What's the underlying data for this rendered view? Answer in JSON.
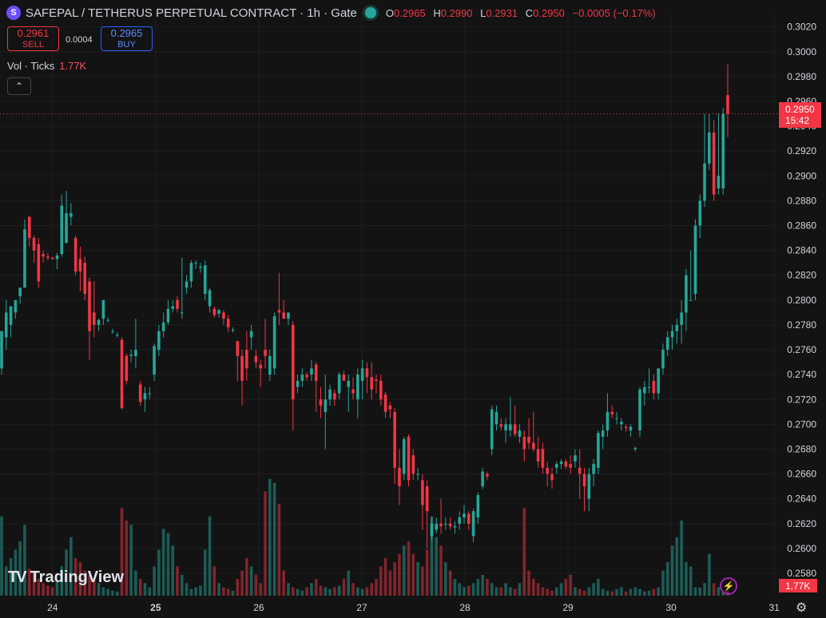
{
  "header": {
    "logo": "S",
    "title": "SAFEPAL / TETHERUS PERPETUAL CONTRACT · 1h · Gate",
    "ohlc": [
      {
        "k": "O",
        "v": "0.2965"
      },
      {
        "k": "H",
        "v": "0.2990"
      },
      {
        "k": "L",
        "v": "0.2931"
      },
      {
        "k": "C",
        "v": "0.2950"
      }
    ],
    "change": "−0.0005 (−0.17%)"
  },
  "trade": {
    "sell_price": "0.2961",
    "sell_label": "SELL",
    "spread": "0.0004",
    "buy_price": "0.2965",
    "buy_label": "BUY"
  },
  "volume_legend": {
    "label": "Vol · Ticks",
    "value": "1.77K"
  },
  "collapse_glyph": "⌃",
  "branding": {
    "mark": "TV",
    "text": "TradingView"
  },
  "colors": {
    "bg": "#131313",
    "up": "#26a69a",
    "down": "#f23645",
    "grid": "#1e1e1e",
    "text": "#d1d4dc"
  },
  "icons": [
    "logo-icon",
    "status-dot-icon",
    "chevron-up-icon",
    "bolt-icon",
    "gear-icon"
  ],
  "chart_data": {
    "type": "candlestick",
    "timeframe": "1h",
    "price_axis": {
      "min": 0.2562,
      "max": 0.3032,
      "ticks": [
        "0.3020",
        "0.3000",
        "0.2980",
        "0.2960",
        "0.2940",
        "0.2920",
        "0.2900",
        "0.2880",
        "0.2860",
        "0.2840",
        "0.2820",
        "0.2800",
        "0.2780",
        "0.2760",
        "0.2740",
        "0.2720",
        "0.2700",
        "0.2680",
        "0.2660",
        "0.2640",
        "0.2620",
        "0.2600",
        "0.2580"
      ]
    },
    "time_axis": [
      {
        "label": "24",
        "x": 24.0,
        "bold": false
      },
      {
        "label": "25",
        "x": 25.0,
        "bold": true
      },
      {
        "label": "26",
        "x": 26.0,
        "bold": false
      },
      {
        "label": "27",
        "x": 27.0,
        "bold": false
      },
      {
        "label": "28",
        "x": 28.0,
        "bold": false
      },
      {
        "label": "29",
        "x": 29.0,
        "bold": false
      },
      {
        "label": "30",
        "x": 30.0,
        "bold": false
      },
      {
        "label": "31",
        "x": 31.0,
        "bold": false
      }
    ],
    "x_range": [
      23.49,
      31.03
    ],
    "current_price": {
      "price": "0.2950",
      "countdown": "15:42",
      "value": 0.295
    },
    "volume_badge": "1.77K",
    "volume_max": 1.77,
    "candles": [
      {
        "o": 0.2745,
        "h": 0.2775,
        "l": 0.274,
        "c": 0.2775
      },
      {
        "o": 0.277,
        "h": 0.28,
        "l": 0.276,
        "c": 0.279
      },
      {
        "o": 0.278,
        "h": 0.2795,
        "l": 0.277,
        "c": 0.2795
      },
      {
        "o": 0.279,
        "h": 0.28,
        "l": 0.2785,
        "c": 0.28
      },
      {
        "o": 0.2803,
        "h": 0.281,
        "l": 0.2797,
        "c": 0.281
      },
      {
        "o": 0.281,
        "h": 0.2865,
        "l": 0.281,
        "c": 0.2857
      },
      {
        "o": 0.2867,
        "h": 0.2868,
        "l": 0.2843,
        "c": 0.285
      },
      {
        "o": 0.285,
        "h": 0.2852,
        "l": 0.283,
        "c": 0.284
      },
      {
        "o": 0.2845,
        "h": 0.285,
        "l": 0.281,
        "c": 0.2815
      },
      {
        "o": 0.2837,
        "h": 0.284,
        "l": 0.283,
        "c": 0.2835
      },
      {
        "o": 0.2835,
        "h": 0.2838,
        "l": 0.2832,
        "c": 0.2834
      },
      {
        "o": 0.2834,
        "h": 0.2835,
        "l": 0.2833,
        "c": 0.2833
      },
      {
        "o": 0.2833,
        "h": 0.2838,
        "l": 0.2825,
        "c": 0.2836
      },
      {
        "o": 0.2837,
        "h": 0.2885,
        "l": 0.2835,
        "c": 0.2876
      },
      {
        "o": 0.2846,
        "h": 0.2888,
        "l": 0.2846,
        "c": 0.287
      },
      {
        "o": 0.2867,
        "h": 0.2878,
        "l": 0.286,
        "c": 0.287
      },
      {
        "o": 0.285,
        "h": 0.2852,
        "l": 0.282,
        "c": 0.2823
      },
      {
        "o": 0.2833,
        "h": 0.2843,
        "l": 0.2807,
        "c": 0.2823
      },
      {
        "o": 0.283,
        "h": 0.2835,
        "l": 0.28,
        "c": 0.2805
      },
      {
        "o": 0.2815,
        "h": 0.2818,
        "l": 0.2752,
        "c": 0.2775
      },
      {
        "o": 0.279,
        "h": 0.2815,
        "l": 0.277,
        "c": 0.278
      },
      {
        "o": 0.278,
        "h": 0.2785,
        "l": 0.2775,
        "c": 0.2784
      },
      {
        "o": 0.2785,
        "h": 0.28,
        "l": 0.278,
        "c": 0.28
      },
      {
        "o": 0.2784,
        "h": 0.2786,
        "l": 0.2782,
        "c": 0.2784
      },
      {
        "o": 0.2775,
        "h": 0.2777,
        "l": 0.2773,
        "c": 0.2775
      },
      {
        "o": 0.2772,
        "h": 0.2774,
        "l": 0.277,
        "c": 0.2772
      },
      {
        "o": 0.2768,
        "h": 0.277,
        "l": 0.2712,
        "c": 0.2713
      },
      {
        "o": 0.2755,
        "h": 0.2757,
        "l": 0.2732,
        "c": 0.2735
      },
      {
        "o": 0.2755,
        "h": 0.276,
        "l": 0.275,
        "c": 0.2756
      },
      {
        "o": 0.2755,
        "h": 0.2785,
        "l": 0.2745,
        "c": 0.276
      },
      {
        "o": 0.2732,
        "h": 0.2735,
        "l": 0.2715,
        "c": 0.2718
      },
      {
        "o": 0.272,
        "h": 0.273,
        "l": 0.271,
        "c": 0.2725
      },
      {
        "o": 0.2725,
        "h": 0.273,
        "l": 0.272,
        "c": 0.2725
      },
      {
        "o": 0.274,
        "h": 0.2765,
        "l": 0.2735,
        "c": 0.2763
      },
      {
        "o": 0.276,
        "h": 0.278,
        "l": 0.2755,
        "c": 0.2775
      },
      {
        "o": 0.2775,
        "h": 0.279,
        "l": 0.277,
        "c": 0.2782
      },
      {
        "o": 0.2782,
        "h": 0.28,
        "l": 0.278,
        "c": 0.2793
      },
      {
        "o": 0.2793,
        "h": 0.28,
        "l": 0.279,
        "c": 0.2795
      },
      {
        "o": 0.28,
        "h": 0.2803,
        "l": 0.279,
        "c": 0.2793
      },
      {
        "o": 0.279,
        "h": 0.2834,
        "l": 0.2785,
        "c": 0.279
      },
      {
        "o": 0.281,
        "h": 0.282,
        "l": 0.2805,
        "c": 0.2815
      },
      {
        "o": 0.2815,
        "h": 0.2832,
        "l": 0.281,
        "c": 0.283
      },
      {
        "o": 0.283,
        "h": 0.2832,
        "l": 0.2825,
        "c": 0.283
      },
      {
        "o": 0.2826,
        "h": 0.283,
        "l": 0.2822,
        "c": 0.2827
      },
      {
        "o": 0.2805,
        "h": 0.2832,
        "l": 0.28,
        "c": 0.2828
      },
      {
        "o": 0.2795,
        "h": 0.281,
        "l": 0.279,
        "c": 0.2808
      },
      {
        "o": 0.2793,
        "h": 0.2795,
        "l": 0.2786,
        "c": 0.2788
      },
      {
        "o": 0.2789,
        "h": 0.2793,
        "l": 0.2786,
        "c": 0.2792
      },
      {
        "o": 0.279,
        "h": 0.2792,
        "l": 0.278,
        "c": 0.2785
      },
      {
        "o": 0.2785,
        "h": 0.2788,
        "l": 0.2774,
        "c": 0.2778
      },
      {
        "o": 0.2776,
        "h": 0.2778,
        "l": 0.2774,
        "c": 0.2776
      },
      {
        "o": 0.2767,
        "h": 0.276,
        "l": 0.2735,
        "c": 0.2755
      },
      {
        "o": 0.2755,
        "h": 0.276,
        "l": 0.2715,
        "c": 0.2735
      },
      {
        "o": 0.276,
        "h": 0.2775,
        "l": 0.2735,
        "c": 0.2745
      },
      {
        "o": 0.277,
        "h": 0.278,
        "l": 0.276,
        "c": 0.2775
      },
      {
        "o": 0.2755,
        "h": 0.276,
        "l": 0.2745,
        "c": 0.275
      },
      {
        "o": 0.2748,
        "h": 0.2752,
        "l": 0.273,
        "c": 0.2745
      },
      {
        "o": 0.276,
        "h": 0.2785,
        "l": 0.2745,
        "c": 0.2755
      },
      {
        "o": 0.274,
        "h": 0.276,
        "l": 0.2735,
        "c": 0.2755
      },
      {
        "o": 0.2745,
        "h": 0.279,
        "l": 0.274,
        "c": 0.2787
      },
      {
        "o": 0.2792,
        "h": 0.2822,
        "l": 0.278,
        "c": 0.279
      },
      {
        "o": 0.279,
        "h": 0.28,
        "l": 0.2785,
        "c": 0.2785
      },
      {
        "o": 0.2785,
        "h": 0.279,
        "l": 0.278,
        "c": 0.279
      },
      {
        "o": 0.278,
        "h": 0.2783,
        "l": 0.2695,
        "c": 0.272
      },
      {
        "o": 0.273,
        "h": 0.274,
        "l": 0.2725,
        "c": 0.2735
      },
      {
        "o": 0.2735,
        "h": 0.2745,
        "l": 0.273,
        "c": 0.274
      },
      {
        "o": 0.274,
        "h": 0.2742,
        "l": 0.2735,
        "c": 0.2738
      },
      {
        "o": 0.274,
        "h": 0.2752,
        "l": 0.2735,
        "c": 0.2745
      },
      {
        "o": 0.2748,
        "h": 0.275,
        "l": 0.271,
        "c": 0.2735
      },
      {
        "o": 0.272,
        "h": 0.273,
        "l": 0.2705,
        "c": 0.2715
      },
      {
        "o": 0.271,
        "h": 0.274,
        "l": 0.268,
        "c": 0.272
      },
      {
        "o": 0.272,
        "h": 0.2732,
        "l": 0.2715,
        "c": 0.2728
      },
      {
        "o": 0.2725,
        "h": 0.2728,
        "l": 0.2715,
        "c": 0.272
      },
      {
        "o": 0.2725,
        "h": 0.2742,
        "l": 0.272,
        "c": 0.274
      },
      {
        "o": 0.274,
        "h": 0.2743,
        "l": 0.2735,
        "c": 0.2735
      },
      {
        "o": 0.273,
        "h": 0.274,
        "l": 0.271,
        "c": 0.2735
      },
      {
        "o": 0.2728,
        "h": 0.2738,
        "l": 0.272,
        "c": 0.2725
      },
      {
        "o": 0.272,
        "h": 0.2745,
        "l": 0.2705,
        "c": 0.274
      },
      {
        "o": 0.2735,
        "h": 0.2752,
        "l": 0.272,
        "c": 0.2745
      },
      {
        "o": 0.2745,
        "h": 0.275,
        "l": 0.2725,
        "c": 0.2738
      },
      {
        "o": 0.2738,
        "h": 0.275,
        "l": 0.272,
        "c": 0.2728
      },
      {
        "o": 0.2736,
        "h": 0.274,
        "l": 0.2725,
        "c": 0.2735
      },
      {
        "o": 0.2735,
        "h": 0.274,
        "l": 0.2715,
        "c": 0.272
      },
      {
        "o": 0.2724,
        "h": 0.2726,
        "l": 0.2705,
        "c": 0.271
      },
      {
        "o": 0.2715,
        "h": 0.2718,
        "l": 0.2705,
        "c": 0.2712
      },
      {
        "o": 0.271,
        "h": 0.2713,
        "l": 0.2652,
        "c": 0.2665
      },
      {
        "o": 0.2665,
        "h": 0.268,
        "l": 0.2635,
        "c": 0.265
      },
      {
        "o": 0.266,
        "h": 0.269,
        "l": 0.2655,
        "c": 0.2688
      },
      {
        "o": 0.269,
        "h": 0.2692,
        "l": 0.265,
        "c": 0.2655
      },
      {
        "o": 0.2675,
        "h": 0.268,
        "l": 0.2655,
        "c": 0.266
      },
      {
        "o": 0.266,
        "h": 0.2665,
        "l": 0.2655,
        "c": 0.266
      },
      {
        "o": 0.2655,
        "h": 0.266,
        "l": 0.2615,
        "c": 0.2635
      },
      {
        "o": 0.265,
        "h": 0.2655,
        "l": 0.26,
        "c": 0.263
      },
      {
        "o": 0.261,
        "h": 0.2625,
        "l": 0.2606,
        "c": 0.262
      },
      {
        "o": 0.2615,
        "h": 0.2625,
        "l": 0.2612,
        "c": 0.262
      },
      {
        "o": 0.262,
        "h": 0.264,
        "l": 0.2612,
        "c": 0.2618
      },
      {
        "o": 0.262,
        "h": 0.2625,
        "l": 0.2615,
        "c": 0.262
      },
      {
        "o": 0.262,
        "h": 0.2625,
        "l": 0.2615,
        "c": 0.2618
      },
      {
        "o": 0.2617,
        "h": 0.2622,
        "l": 0.2612,
        "c": 0.2618
      },
      {
        "o": 0.262,
        "h": 0.263,
        "l": 0.2615,
        "c": 0.2625
      },
      {
        "o": 0.2625,
        "h": 0.2635,
        "l": 0.262,
        "c": 0.2628
      },
      {
        "o": 0.2628,
        "h": 0.263,
        "l": 0.2615,
        "c": 0.262
      },
      {
        "o": 0.261,
        "h": 0.2632,
        "l": 0.2605,
        "c": 0.263
      },
      {
        "o": 0.2625,
        "h": 0.2645,
        "l": 0.262,
        "c": 0.2643
      },
      {
        "o": 0.265,
        "h": 0.2665,
        "l": 0.2648,
        "c": 0.2662
      },
      {
        "o": 0.266,
        "h": 0.2662,
        "l": 0.2655,
        "c": 0.2658
      },
      {
        "o": 0.268,
        "h": 0.2715,
        "l": 0.2675,
        "c": 0.2712
      },
      {
        "o": 0.27,
        "h": 0.2715,
        "l": 0.2695,
        "c": 0.271
      },
      {
        "o": 0.27,
        "h": 0.2705,
        "l": 0.2695,
        "c": 0.2698
      },
      {
        "o": 0.2695,
        "h": 0.2705,
        "l": 0.2685,
        "c": 0.27
      },
      {
        "o": 0.2695,
        "h": 0.2722,
        "l": 0.269,
        "c": 0.27
      },
      {
        "o": 0.27,
        "h": 0.2715,
        "l": 0.269,
        "c": 0.2692
      },
      {
        "o": 0.269,
        "h": 0.27,
        "l": 0.2685,
        "c": 0.2695
      },
      {
        "o": 0.269,
        "h": 0.2695,
        "l": 0.267,
        "c": 0.268
      },
      {
        "o": 0.269,
        "h": 0.2705,
        "l": 0.268,
        "c": 0.2685
      },
      {
        "o": 0.2685,
        "h": 0.271,
        "l": 0.2678,
        "c": 0.268
      },
      {
        "o": 0.268,
        "h": 0.269,
        "l": 0.2665,
        "c": 0.267
      },
      {
        "o": 0.268,
        "h": 0.2685,
        "l": 0.266,
        "c": 0.2665
      },
      {
        "o": 0.2665,
        "h": 0.267,
        "l": 0.265,
        "c": 0.266
      },
      {
        "o": 0.266,
        "h": 0.2665,
        "l": 0.2648,
        "c": 0.2655
      },
      {
        "o": 0.2665,
        "h": 0.267,
        "l": 0.266,
        "c": 0.2668
      },
      {
        "o": 0.2668,
        "h": 0.2672,
        "l": 0.2664,
        "c": 0.267
      },
      {
        "o": 0.267,
        "h": 0.2672,
        "l": 0.2664,
        "c": 0.2666
      },
      {
        "o": 0.2668,
        "h": 0.2675,
        "l": 0.266,
        "c": 0.2665
      },
      {
        "o": 0.267,
        "h": 0.268,
        "l": 0.2665,
        "c": 0.2675
      },
      {
        "o": 0.2665,
        "h": 0.268,
        "l": 0.264,
        "c": 0.266
      },
      {
        "o": 0.266,
        "h": 0.2665,
        "l": 0.263,
        "c": 0.265
      },
      {
        "o": 0.264,
        "h": 0.2665,
        "l": 0.263,
        "c": 0.266
      },
      {
        "o": 0.266,
        "h": 0.2672,
        "l": 0.265,
        "c": 0.2668
      },
      {
        "o": 0.2665,
        "h": 0.2695,
        "l": 0.266,
        "c": 0.2693
      },
      {
        "o": 0.269,
        "h": 0.27,
        "l": 0.268,
        "c": 0.2695
      },
      {
        "o": 0.2695,
        "h": 0.2725,
        "l": 0.269,
        "c": 0.271
      },
      {
        "o": 0.271,
        "h": 0.2715,
        "l": 0.2705,
        "c": 0.2708
      },
      {
        "o": 0.2705,
        "h": 0.271,
        "l": 0.27,
        "c": 0.2705
      },
      {
        "o": 0.27,
        "h": 0.2705,
        "l": 0.2695,
        "c": 0.2702
      },
      {
        "o": 0.2698,
        "h": 0.27,
        "l": 0.2694,
        "c": 0.2697
      },
      {
        "o": 0.2695,
        "h": 0.27,
        "l": 0.269,
        "c": 0.2698
      },
      {
        "o": 0.268,
        "h": 0.2682,
        "l": 0.2678,
        "c": 0.2681
      },
      {
        "o": 0.2695,
        "h": 0.273,
        "l": 0.269,
        "c": 0.2728
      },
      {
        "o": 0.2725,
        "h": 0.2735,
        "l": 0.2715,
        "c": 0.273
      },
      {
        "o": 0.273,
        "h": 0.2745,
        "l": 0.2725,
        "c": 0.273
      },
      {
        "o": 0.2735,
        "h": 0.274,
        "l": 0.272,
        "c": 0.2725
      },
      {
        "o": 0.2725,
        "h": 0.2745,
        "l": 0.272,
        "c": 0.2745
      },
      {
        "o": 0.2745,
        "h": 0.2765,
        "l": 0.274,
        "c": 0.276
      },
      {
        "o": 0.276,
        "h": 0.2775,
        "l": 0.2755,
        "c": 0.277
      },
      {
        "o": 0.277,
        "h": 0.278,
        "l": 0.276,
        "c": 0.2775
      },
      {
        "o": 0.2775,
        "h": 0.2785,
        "l": 0.2765,
        "c": 0.278
      },
      {
        "o": 0.278,
        "h": 0.28,
        "l": 0.2765,
        "c": 0.279
      },
      {
        "o": 0.279,
        "h": 0.2825,
        "l": 0.2775,
        "c": 0.282
      },
      {
        "o": 0.28,
        "h": 0.284,
        "l": 0.28,
        "c": 0.28
      },
      {
        "o": 0.2805,
        "h": 0.2865,
        "l": 0.28,
        "c": 0.286
      },
      {
        "o": 0.286,
        "h": 0.2885,
        "l": 0.285,
        "c": 0.288
      },
      {
        "o": 0.288,
        "h": 0.295,
        "l": 0.2875,
        "c": 0.291
      },
      {
        "o": 0.291,
        "h": 0.295,
        "l": 0.2905,
        "c": 0.2935
      },
      {
        "o": 0.2935,
        "h": 0.2945,
        "l": 0.288,
        "c": 0.2885
      },
      {
        "o": 0.289,
        "h": 0.295,
        "l": 0.2885,
        "c": 0.29
      },
      {
        "o": 0.289,
        "h": 0.2955,
        "l": 0.2885,
        "c": 0.295
      },
      {
        "o": 0.2965,
        "h": 0.299,
        "l": 0.2931,
        "c": 0.295
      }
    ],
    "volume": [
      0.95,
      0.35,
      0.45,
      0.55,
      0.65,
      0.85,
      0.32,
      0.28,
      0.2,
      0.15,
      0.12,
      0.1,
      0.18,
      0.35,
      0.55,
      0.7,
      0.45,
      0.4,
      0.3,
      0.25,
      0.2,
      0.15,
      0.1,
      0.08,
      0.06,
      0.05,
      1.05,
      0.9,
      0.85,
      0.3,
      0.2,
      0.15,
      0.1,
      0.35,
      0.55,
      0.8,
      0.75,
      0.6,
      0.35,
      0.25,
      0.15,
      0.08,
      0.1,
      0.12,
      0.55,
      0.95,
      0.35,
      0.15,
      0.1,
      0.08,
      0.06,
      0.2,
      0.3,
      0.45,
      0.35,
      0.25,
      0.15,
      1.25,
      1.4,
      1.35,
      1.1,
      0.3,
      0.15,
      0.1,
      0.08,
      0.06,
      0.1,
      0.15,
      0.2,
      0.12,
      0.1,
      0.08,
      0.1,
      0.12,
      0.2,
      0.3,
      0.15,
      0.1,
      0.08,
      0.1,
      0.15,
      0.2,
      0.35,
      0.45,
      0.3,
      0.4,
      0.5,
      0.6,
      0.65,
      0.5,
      0.4,
      0.35,
      0.55,
      0.95,
      0.7,
      0.6,
      0.4,
      0.3,
      0.2,
      0.15,
      0.1,
      0.12,
      0.15,
      0.2,
      0.25,
      0.2,
      0.15,
      0.1,
      0.1,
      0.15,
      0.1,
      0.08,
      0.15,
      1.05,
      0.3,
      0.2,
      0.15,
      0.1,
      0.08,
      0.06,
      0.1,
      0.15,
      0.2,
      0.25,
      0.1,
      0.08,
      0.06,
      0.1,
      0.15,
      0.2,
      0.08,
      0.06,
      0.05,
      0.08,
      0.1,
      0.05,
      0.08,
      0.1,
      0.08,
      0.05,
      0.06,
      0.08,
      0.1,
      0.3,
      0.4,
      0.6,
      0.7,
      0.9,
      0.4,
      0.35,
      0.1,
      0.1,
      0.15,
      0.5,
      0.15,
      0.1,
      0.05,
      0.05
    ]
  }
}
